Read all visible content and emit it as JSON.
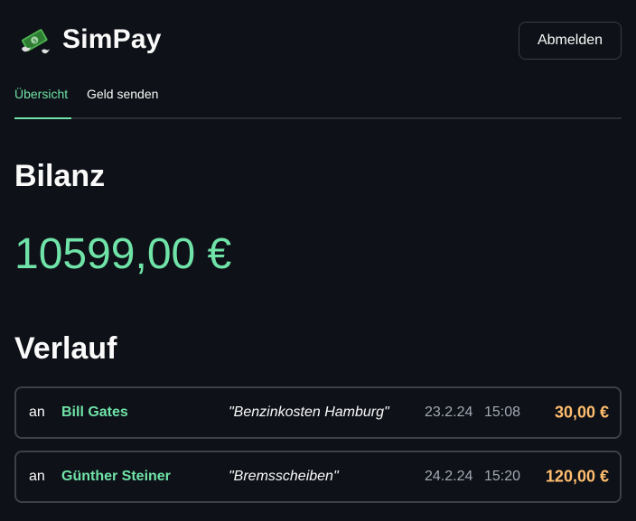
{
  "app": {
    "title": "SimPay",
    "logo_icon": "money-with-wings-icon"
  },
  "header": {
    "logout_label": "Abmelden"
  },
  "tabs": [
    {
      "label": "Übersicht",
      "active": true
    },
    {
      "label": "Geld senden",
      "active": false
    }
  ],
  "balance": {
    "heading": "Bilanz",
    "amount": "10599,00 €"
  },
  "history": {
    "heading": "Verlauf",
    "transactions": [
      {
        "direction": "an",
        "name": "Bill Gates",
        "note": "\"Benzinkosten Hamburg\"",
        "date": "23.2.24",
        "time": "15:08",
        "amount": "30,00 €"
      },
      {
        "direction": "an",
        "name": "Günther Steiner",
        "note": "\"Bremsscheiben\"",
        "date": "24.2.24",
        "time": "15:20",
        "amount": "120,00 €"
      }
    ]
  },
  "colors": {
    "background": "#0e1117",
    "accent_green": "#6fe3a8",
    "amount_orange": "#ffbd6e",
    "border": "#3d4047"
  }
}
